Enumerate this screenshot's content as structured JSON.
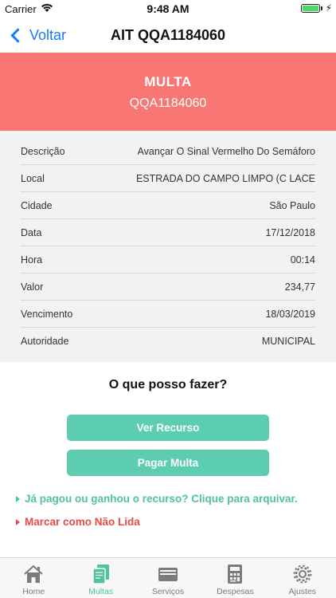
{
  "statusbar": {
    "carrier": "Carrier",
    "time": "9:48 AM"
  },
  "nav": {
    "back_label": "Voltar",
    "title": "AIT QQA1184060"
  },
  "banner": {
    "kind": "MULTA",
    "code": "QQA1184060",
    "color": "#f87774"
  },
  "details": [
    {
      "label": "Descrição",
      "value": "Avançar O Sinal Vermelho Do Semáforo"
    },
    {
      "label": "Local",
      "value": "ESTRADA DO CAMPO LIMPO (C LACE"
    },
    {
      "label": "Cidade",
      "value": "São Paulo"
    },
    {
      "label": "Data",
      "value": "17/12/2018"
    },
    {
      "label": "Hora",
      "value": "00:14"
    },
    {
      "label": "Valor",
      "value": "234,77"
    },
    {
      "label": "Vencimento",
      "value": "18/03/2019"
    },
    {
      "label": "Autoridade",
      "value": "MUNICIPAL"
    }
  ],
  "actions": {
    "question": "O que posso fazer?",
    "ver_recurso": "Ver Recurso",
    "pagar_multa": "Pagar Multa",
    "archive_link": "Já pagou ou ganhou o recurso? Clique para arquivar.",
    "unread_link": "Marcar como Não Lida"
  },
  "tabs": [
    {
      "label": "Home",
      "icon": "home-icon"
    },
    {
      "label": "Multas",
      "icon": "documents-icon",
      "active": true
    },
    {
      "label": "Serviços",
      "icon": "wallet-icon"
    },
    {
      "label": "Despesas",
      "icon": "calculator-icon"
    },
    {
      "label": "Ajustes",
      "icon": "gear-icon"
    }
  ],
  "colors": {
    "accent": "#5ccdb0",
    "link_blue": "#1a7bf5",
    "danger": "#e84a4a"
  }
}
